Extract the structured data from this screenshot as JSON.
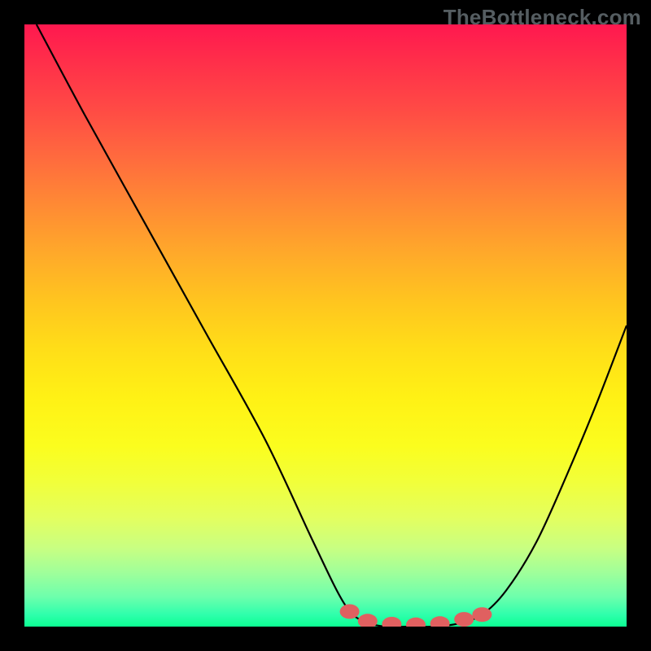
{
  "watermark": "TheBottleneck.com",
  "chart_data": {
    "type": "line",
    "title": "",
    "xlabel": "",
    "ylabel": "",
    "xlim": [
      0,
      100
    ],
    "ylim": [
      0,
      100
    ],
    "series": [
      {
        "name": "curve",
        "color": "#000000",
        "x": [
          2,
          10,
          20,
          30,
          40,
          48,
          53,
          56,
          60,
          64,
          68,
          72,
          76,
          80,
          85,
          90,
          95,
          100
        ],
        "y": [
          100,
          85,
          67,
          49,
          31,
          14,
          4,
          1,
          0,
          0,
          0,
          0.5,
          2,
          6,
          14,
          25,
          37,
          50
        ]
      }
    ],
    "markers": {
      "name": "flat-region",
      "color": "#e06060",
      "points": [
        {
          "x": 54,
          "y": 2.5
        },
        {
          "x": 57,
          "y": 0.9
        },
        {
          "x": 61,
          "y": 0.4
        },
        {
          "x": 65,
          "y": 0.3
        },
        {
          "x": 69,
          "y": 0.5
        },
        {
          "x": 73,
          "y": 1.2
        },
        {
          "x": 76,
          "y": 2.0
        }
      ]
    },
    "gradient_stops": [
      {
        "pos": 0,
        "color": "#ff184f"
      },
      {
        "pos": 50,
        "color": "#ffde18"
      },
      {
        "pos": 100,
        "color": "#0cff93"
      }
    ]
  }
}
